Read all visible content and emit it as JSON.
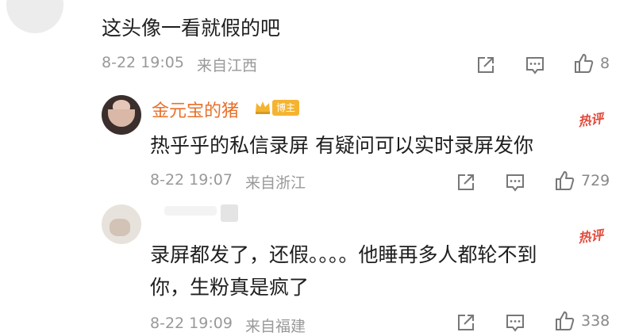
{
  "comments": [
    {
      "text": "这头像一看就假的吧",
      "date": "8-22 19:05",
      "location": "来自江西",
      "likes": "8"
    },
    {
      "user": "金元宝的猪",
      "badge": "博主",
      "hot_label": "热评",
      "text": "热乎乎的私信录屏 有疑问可以实时录屏发你",
      "date": "8-22 19:07",
      "location": "来自浙江",
      "likes": "729"
    },
    {
      "hot_label": "热评",
      "text_line1": "录屏都发了，还假。。。。他睡再多人都轮不到",
      "text_line2": "你，生粉真是疯了",
      "date": "8-22 19:09",
      "location": "来自福建",
      "likes": "338"
    }
  ],
  "colors": {
    "username": "#e8702a",
    "hot": "#e24a3b",
    "meta": "#999999",
    "badge": "#f4b431"
  },
  "icons": [
    "share-icon",
    "comment-icon",
    "like-icon",
    "crown-icon"
  ]
}
